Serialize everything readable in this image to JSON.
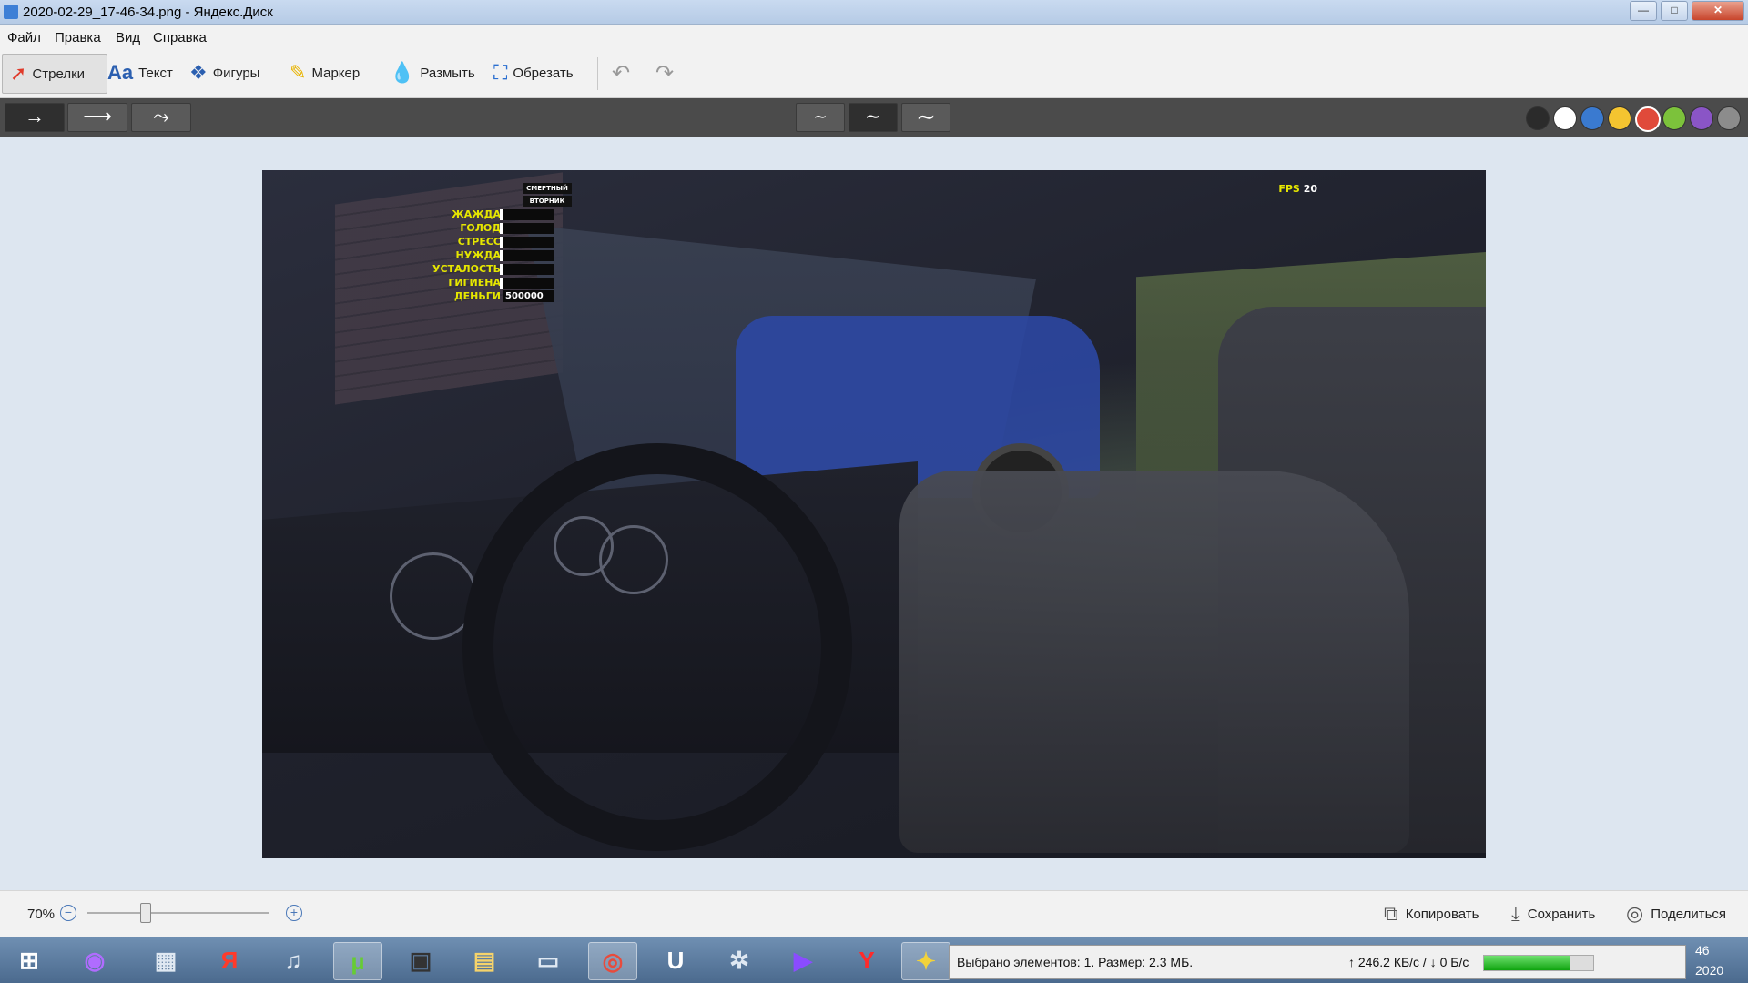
{
  "window": {
    "title": "2020-02-29_17-46-34.png - Яндекс.Диск",
    "minimize": "—",
    "maximize": "□",
    "close": "✕"
  },
  "menu": [
    "Файл",
    "Правка",
    "Вид",
    "Справка"
  ],
  "tools": [
    {
      "label": "Стрелки",
      "icon": "arrow-icon",
      "active": true
    },
    {
      "label": "Текст",
      "icon": "text-icon"
    },
    {
      "label": "Фигуры",
      "icon": "shapes-icon"
    },
    {
      "label": "Маркер",
      "icon": "marker-icon"
    },
    {
      "label": "Размыть",
      "icon": "blur-drop-icon"
    },
    {
      "label": "Обрезать",
      "icon": "crop-icon"
    }
  ],
  "history": {
    "undo": "↶",
    "redo": "↷"
  },
  "arrow_styles": [
    "→",
    "⟶",
    "⤳"
  ],
  "line_styles": [
    "∼",
    "∼",
    "∼"
  ],
  "colors": [
    "#2b2b2b",
    "#ffffff",
    "#3a7ad0",
    "#f4c430",
    "#e04a3a",
    "#7cc23b",
    "#8a55c6",
    "#8c8c8c"
  ],
  "game_hud": {
    "tags": [
      "СМЕРТНЫЙ",
      "ВТОРНИК"
    ],
    "stats": [
      "ЖАЖДА",
      "ГОЛОД",
      "СТРЕСС",
      "НУЖДА",
      "УСТАЛОСТЬ",
      "ГИГИЕНА"
    ],
    "money_label": "ДЕНЬГИ",
    "money_value": "500000",
    "fps_label": "FPS",
    "fps_value": "20"
  },
  "zoom": {
    "label": "70%",
    "minus": "−",
    "plus": "+",
    "level": 0.35
  },
  "actions": {
    "copy": "Копировать",
    "save": "Сохранить",
    "share": "Поделиться"
  },
  "taskbar_icons": [
    "windows-start-icon",
    "alice-icon",
    "calculator-icon",
    "yandex-icon",
    "volume-icon",
    "utorrent-icon",
    "game-icon",
    "folder-icon",
    "file-icon",
    "chrome-icon",
    "unreal-icon",
    "app-icon",
    "media-icon",
    "yandex-browser-icon",
    "game2-icon"
  ],
  "taskbar_glyphs": [
    "⊞",
    "◉",
    "▦",
    "Я",
    "♫",
    "µ",
    "▣",
    "▤",
    "▭",
    "◎",
    "U",
    "✲",
    "▶",
    "Y",
    "✦"
  ],
  "status": {
    "message": "Выбрано элементов: 1. Размер: 2.3 МБ.",
    "speed": "↑ 246.2 КБ/с / ↓ 0 Б/с",
    "progress": 0.78
  },
  "clock": {
    "time": "46",
    "year": "2020"
  }
}
